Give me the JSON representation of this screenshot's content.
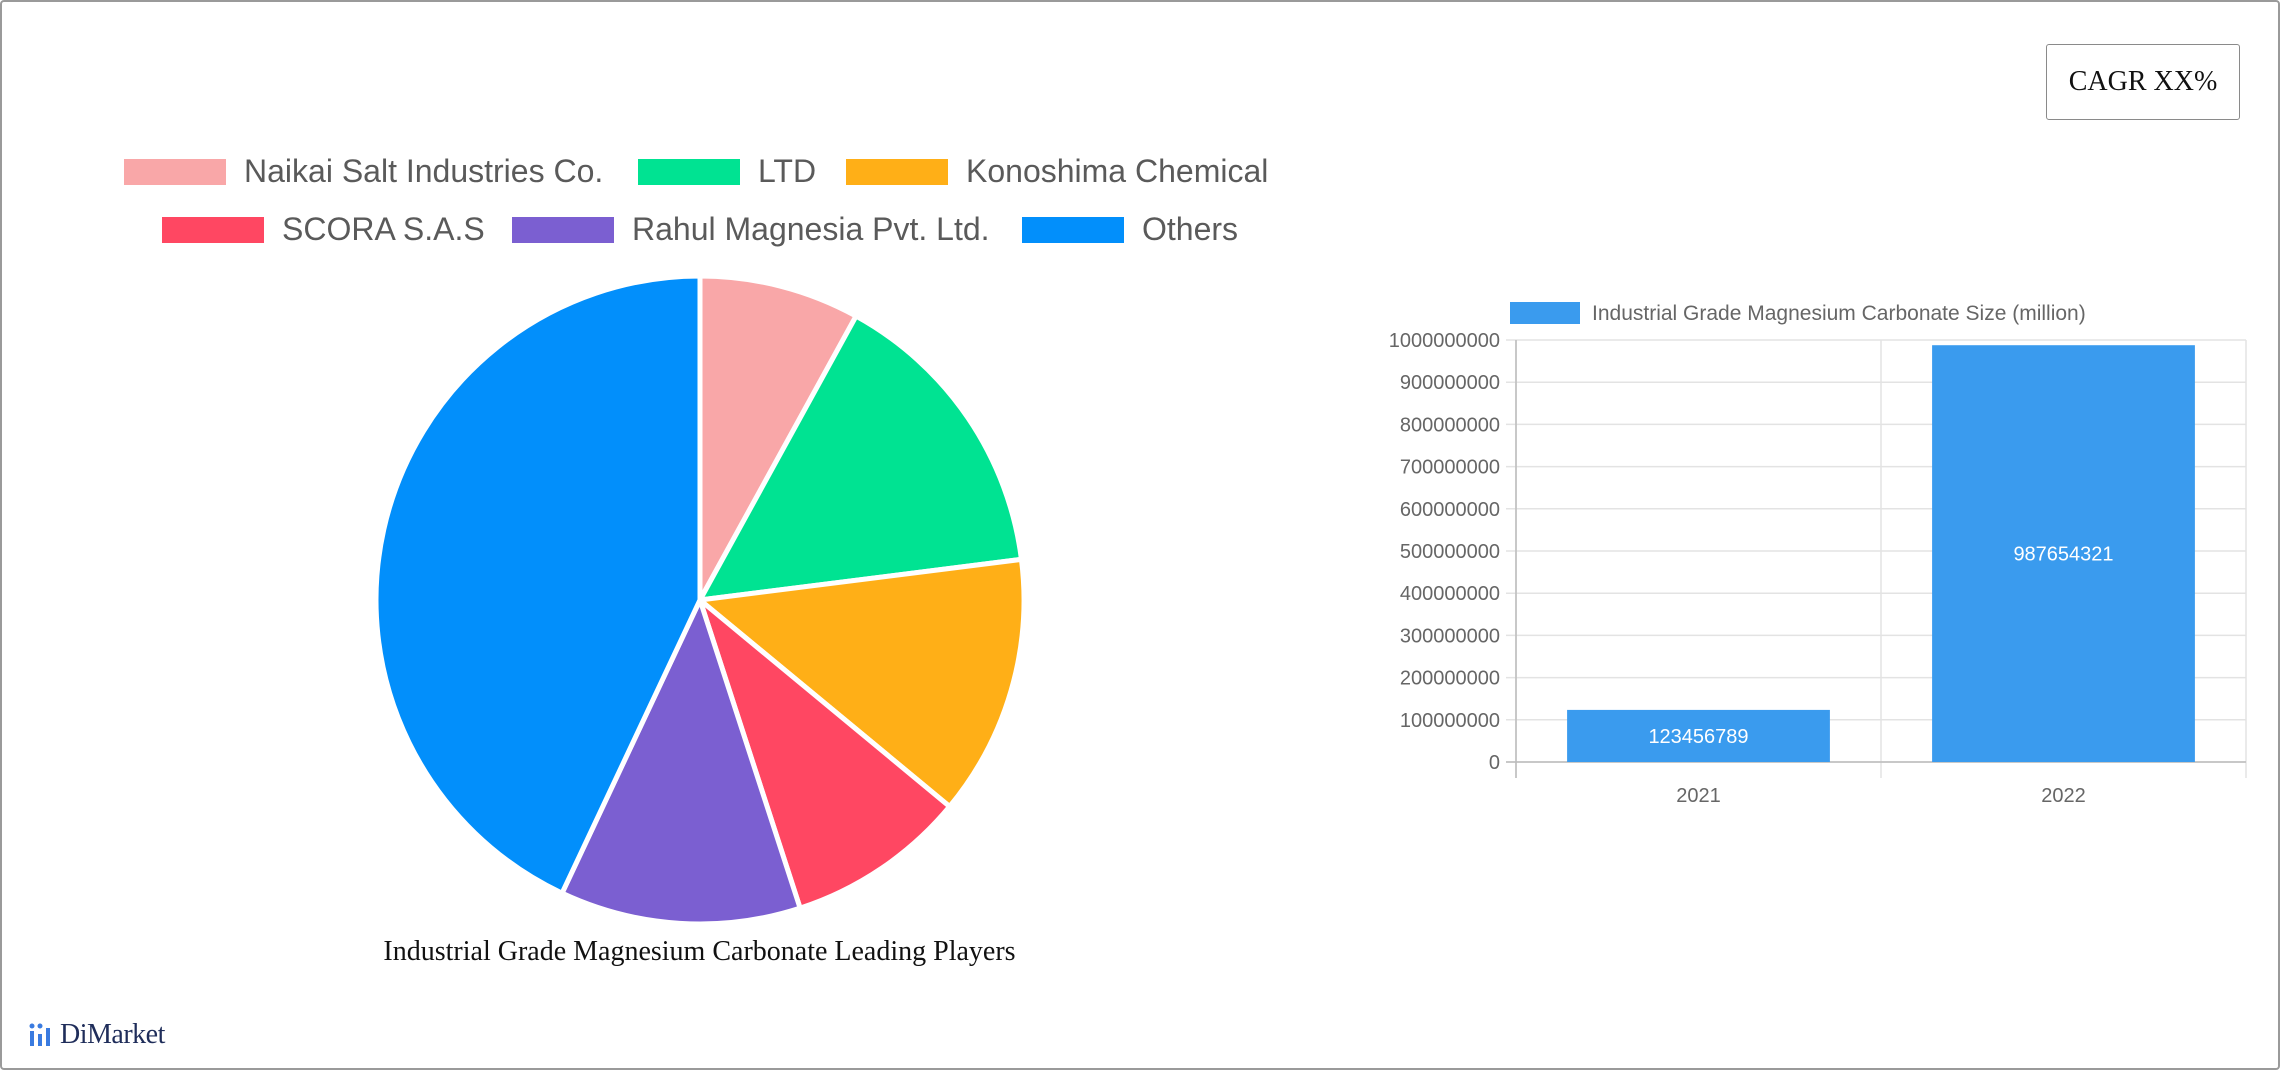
{
  "cagr_label": "CAGR XX%",
  "pie_caption": "Industrial Grade Magnesium Carbonate Leading Players",
  "logo_text": "DiMarket",
  "chart_data": [
    {
      "type": "pie",
      "title": "Industrial Grade Magnesium Carbonate Leading Players",
      "legend_position": "top",
      "categories": [
        "Naikai Salt Industries Co.",
        "LTD",
        "Konoshima Chemical",
        "SCORA S.A.S",
        "Rahul Magnesia Pvt. Ltd.",
        "Others"
      ],
      "values": [
        8,
        15,
        13,
        9,
        12,
        43
      ],
      "colors": [
        "#f9a7a8",
        "#00e392",
        "#ffaf17",
        "#ff4762",
        "#7b5fd1",
        "#028ffb"
      ]
    },
    {
      "type": "bar",
      "categories": [
        "2021",
        "2022"
      ],
      "series": [
        {
          "name": "Industrial Grade Magnesium Carbonate Size (million)",
          "values": [
            123456789,
            987654321
          ],
          "color": "#3a9bee"
        }
      ],
      "yticks": [
        "0",
        "100000000",
        "200000000",
        "300000000",
        "400000000",
        "500000000",
        "600000000",
        "700000000",
        "800000000",
        "900000000",
        "1000000000"
      ],
      "ylim": [
        0,
        1000000000
      ],
      "grid": true,
      "legend_position": "top"
    }
  ]
}
